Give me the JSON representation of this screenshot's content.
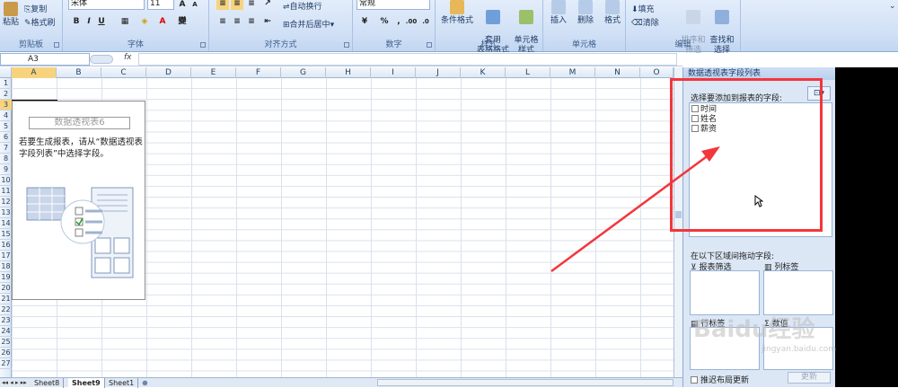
{
  "ribbon": {
    "clipboard": {
      "paste": "粘贴",
      "copy": "复制",
      "format_painter": "格式刷",
      "label": "剪贴板"
    },
    "font": {
      "font_name": "宋体",
      "font_size": "11",
      "bold": "B",
      "italic": "I",
      "underline": "U",
      "label": "字体"
    },
    "alignment": {
      "wrap_text": "自动换行",
      "merge_center": "合并后居中",
      "label": "对齐方式"
    },
    "number": {
      "format": "常规",
      "percent": "%",
      "comma": ",",
      "label": "数字"
    },
    "styles": {
      "conditional": "条件格式",
      "table_style": "套用\n表格格式",
      "cell_style": "单元格\n样式",
      "label": "样式"
    },
    "cells": {
      "insert": "插入",
      "delete": "删除",
      "format": "格式",
      "label": "单元格"
    },
    "editing": {
      "fill": "填充",
      "clear": "清除",
      "sort_filter": "排序和\n筛选",
      "find_select": "查找和\n选择",
      "label": "编辑"
    }
  },
  "formula_bar": {
    "name_box": "A3",
    "fx": "fx"
  },
  "columns": [
    "A",
    "B",
    "C",
    "D",
    "E",
    "F",
    "G",
    "H",
    "I",
    "J",
    "K",
    "L",
    "M",
    "N",
    "O"
  ],
  "rows": [
    "1",
    "2",
    "3",
    "4",
    "5",
    "6",
    "7",
    "8",
    "9",
    "10",
    "11",
    "12",
    "13",
    "14",
    "15",
    "16",
    "17",
    "18",
    "19",
    "20",
    "21",
    "22",
    "23",
    "24",
    "25",
    "26",
    "27"
  ],
  "pivot": {
    "title": "数据透视表6",
    "instructions": "若要生成报表，请从“数据透视表字段列表”中选择字段。"
  },
  "sheet_tabs": [
    "Sheet8",
    "Sheet9",
    "Sheet1"
  ],
  "active_sheet": "Sheet9",
  "panel": {
    "title": "数据透视表字段列表",
    "choose_label": "选择要添加到报表的字段:",
    "fields": [
      "时间",
      "姓名",
      "薪资"
    ],
    "drag_label": "在以下区域间拖动字段:",
    "report_filter": "报表筛选",
    "column_labels": "列标签",
    "row_labels": "行标签",
    "values": "数值",
    "defer_update": "推迟布局更新",
    "update": "更新"
  },
  "watermark": {
    "text": "Baidu经验",
    "url": "jingyan.baidu.com"
  },
  "colors": {
    "annotation_red": "#f2363b",
    "ribbon_bg": "#cfdff5"
  }
}
